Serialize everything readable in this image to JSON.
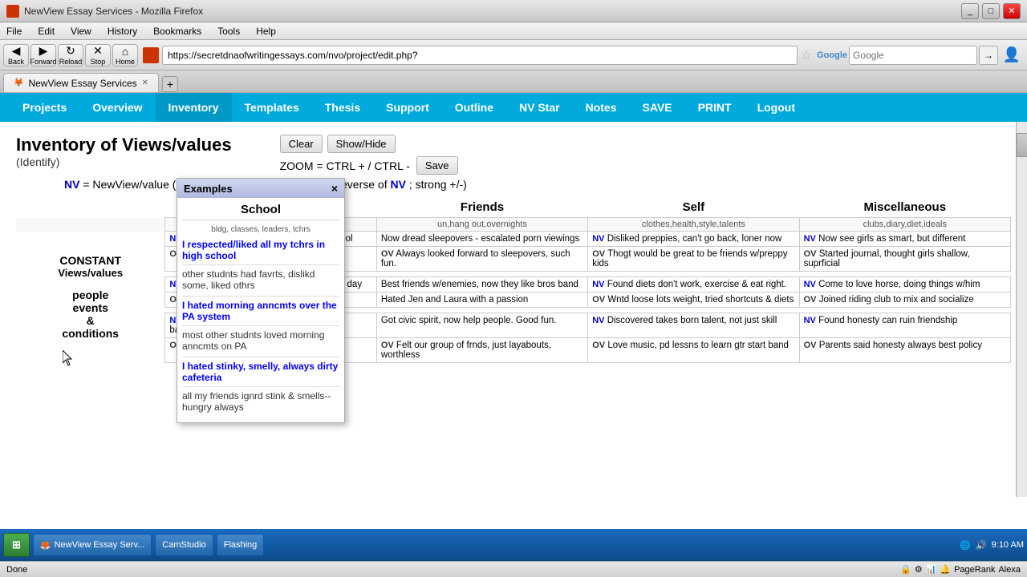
{
  "browser": {
    "title": "NewView Essay Services - Mozilla Firefox",
    "url": "https://secretdnaofwritingessays.com/nvo/project/edit.php?",
    "url_domain": "secretdnaofwritingessays.com",
    "tab_label": "NewView Essay Services",
    "search_placeholder": "Google",
    "menu_items": [
      "File",
      "Edit",
      "View",
      "History",
      "Bookmarks",
      "Tools",
      "Help"
    ],
    "nav_buttons": {
      "back": "Back",
      "forward": "Forward",
      "reload": "Reload",
      "stop": "Stop",
      "home": "Home"
    }
  },
  "app_nav": {
    "items": [
      "Projects",
      "Overview",
      "Inventory",
      "Templates",
      "Thesis",
      "Support",
      "Outline",
      "NV Star",
      "Notes",
      "SAVE",
      "PRINT",
      "Logout"
    ]
  },
  "page": {
    "title": "Inventory of Views/values",
    "subtitle": "(Identify)",
    "clear_btn": "Clear",
    "show_hide_btn": "Show/Hide",
    "zoom_text": "ZOOM = CTRL + / CTRL -",
    "save_btn": "Save",
    "nv_formula": "NV = NewView/value (new belief OV = OldView/value (reverse of NV; strong +/-)"
  },
  "popup": {
    "title": "Examples",
    "close": "×",
    "section_title": "School",
    "section_sub": "bldg, classes, leaders, tchrs",
    "entries": [
      {
        "nv": "I respected/liked all my tchrs in high school",
        "ov": "other studnts had favrts, dislikd some, liked othrs"
      },
      {
        "nv": "I hated morning anncmts over the PA system",
        "ov": "most other studnts loved morning anncmts on PA"
      },
      {
        "nv": "I hated stinky, smelly, always dirty cafeteria",
        "ov": "all my friends ignrd stink & smells--hungry always"
      }
    ]
  },
  "table": {
    "columns": [
      "School",
      "Friends",
      "Self",
      "Miscellaneous"
    ],
    "subheaders": {
      "school": "bldg,classes,leaders,tchrs",
      "friends": "un,hang out,overnights",
      "self": "clothes,health,style,talents",
      "misc": "clubs,diary,diet,ideals"
    },
    "left_label": {
      "line1": "CONSTANT",
      "line2": "Views/values",
      "line3": "",
      "line4": "people",
      "line5": "events",
      "line6": "&",
      "line7": "conditions"
    },
    "rows": [
      {
        "school_nv": "I really liked my last Engl tchr in hi school",
        "school_ov": "",
        "friends_nv": "Now dread sleepovers - escalated porn viewings",
        "friends_ov": "Always looked forward to sleepovers, such fun.",
        "self_nv": "Disliked preppies, can't go back, loner now",
        "self_ov": "Thogt would be great to be friends w/preppy kids",
        "misc_nv": "Now see girls as smart, but different",
        "misc_ov": "Started journal, thought girls shallow, suprficial"
      },
      {
        "school_nv": "I liked the patriotic flag ceremony every day",
        "school_ov": "",
        "friends_nv": "Best friends w/enemies, now they like bros band",
        "friends_ov": "",
        "self_nv": "Found diets don't work, exercise & eat right.",
        "self_ov": "Wntd loose lots weight, tried shortcuts & diets",
        "misc_nv": "Come to love horse, doing things w/him",
        "misc_ov": "Joined riding club to mix and socialize"
      },
      {
        "school_nv": "I hated the dirty, smelly, always messy bathrooms",
        "school_ov": "",
        "friends_nv": "Got civic spirit, now help people.  Good fun.",
        "friends_ov": "Felt our group of frnds, just layabouts, worthless",
        "self_nv": "Discovered takes born talent, not just skill",
        "self_ov": "Love music, pd lessns to learn gtr start band",
        "misc_nv": "Found honesty can ruin friendship",
        "misc_ov": "Parents said honesty always best policy"
      }
    ],
    "friends_row2_nv": "Hated Jen and Laura with a passion",
    "friends_row2_ov": ""
  },
  "status": {
    "text": "Done",
    "time": "9:10 AM",
    "page_rank": "PageRank",
    "alexa": "Alexa"
  },
  "taskbar": {
    "start_label": "⊞",
    "tasks": [
      "NewView Essay Serv...",
      "CamStudio",
      "Flashing"
    ]
  }
}
